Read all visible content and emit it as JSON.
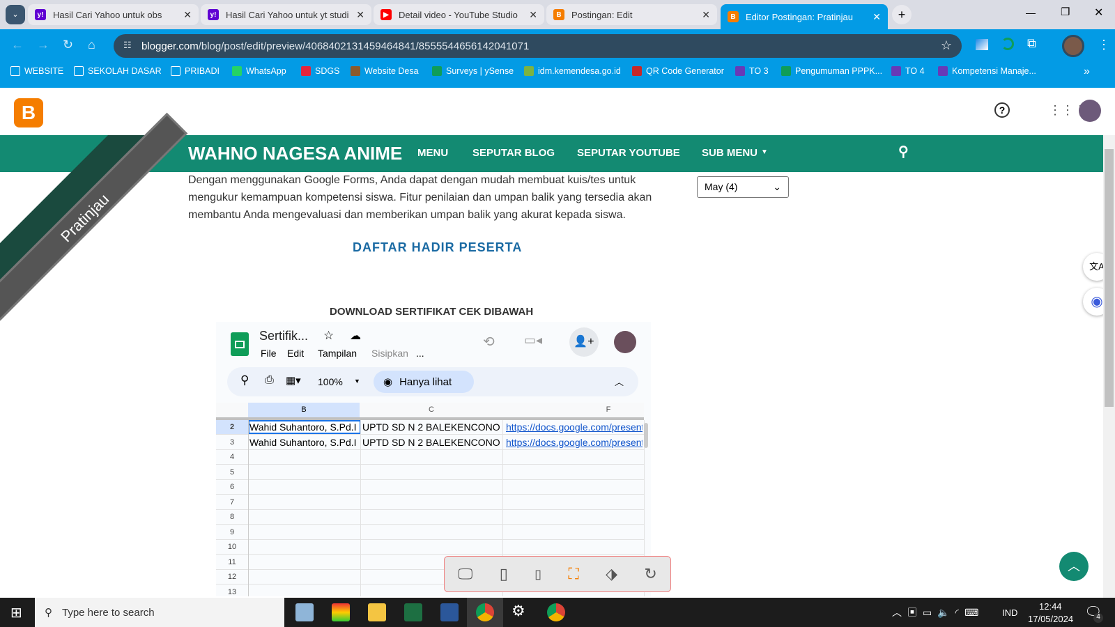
{
  "browser": {
    "tabs": [
      {
        "label": "Hasil Cari Yahoo untuk obs",
        "icon": "yahoo-icon",
        "color": "#6001d2",
        "glyph": "y!"
      },
      {
        "label": "Hasil Cari Yahoo untuk yt studio",
        "icon": "yahoo-icon",
        "color": "#6001d2",
        "glyph": "y!"
      },
      {
        "label": "Detail video - YouTube Studio",
        "icon": "youtube-icon",
        "color": "#ff0000",
        "glyph": "▶"
      },
      {
        "label": "Postingan: Edit",
        "icon": "blogger-icon",
        "color": "#f57d00",
        "glyph": "B"
      },
      {
        "label": "Editor Postingan: Pratinjau",
        "icon": "blogger-icon",
        "color": "#f57d00",
        "glyph": "B"
      }
    ],
    "url_domain": "blogger.com",
    "url_path": "/blog/post/edit/preview/4068402131459464841/8555544656142041071",
    "bookmarks": [
      "WEBSITE",
      "SEKOLAH DASAR",
      "PRIBADI",
      "WhatsApp",
      "SDGS",
      "Website Desa",
      "Surveys | ySense",
      "idm.kemendesa.go.id",
      "QR Code Generator",
      "TO 3",
      "Pengumuman PPPK...",
      "TO 4",
      "Kompetensi Manaje..."
    ]
  },
  "site": {
    "title": "WAHNO NAGESA ANIME",
    "nav": [
      "MENU",
      "SEPUTAR BLOG",
      "SEPUTAR YOUTUBE",
      "SUB MENU"
    ],
    "ribbon": "Pratinjau",
    "paragraph": "Dengan menggunakan Google Forms, Anda dapat dengan mudah membuat kuis/tes untuk mengukur kemampuan kompetensi siswa. Fitur penilaian dan umpan balik yang tersedia akan membantu Anda mengevaluasi dan memberikan umpan balik yang akurat kepada siswa.",
    "heading": "DAFTAR HADIR PESERTA",
    "subheading": "DOWNLOAD SERTIFIKAT CEK DIBAWAH",
    "archive_select": "May (4)"
  },
  "sheet": {
    "title": "Sertifik...",
    "menus": [
      "File",
      "Edit",
      "Tampilan",
      "Sisipkan",
      "..."
    ],
    "zoom": "100%",
    "view_mode": "Hanya lihat",
    "columns": [
      "B",
      "C",
      "F"
    ],
    "rows": [
      {
        "n": "2",
        "b": "Wahid Suhantoro, S.Pd.I",
        "c": "UPTD SD N 2 BALEKENCONO",
        "f": "https://docs.google.com/present"
      },
      {
        "n": "3",
        "b": "Wahid Suhantoro, S.Pd.I",
        "c": "UPTD SD N 2 BALEKENCONO",
        "f": "https://docs.google.com/present"
      },
      {
        "n": "4"
      },
      {
        "n": "5"
      },
      {
        "n": "6"
      },
      {
        "n": "7"
      },
      {
        "n": "8"
      },
      {
        "n": "9"
      },
      {
        "n": "10"
      },
      {
        "n": "11"
      },
      {
        "n": "12"
      },
      {
        "n": "13"
      }
    ]
  },
  "taskbar": {
    "search_placeholder": "Type here to search",
    "lang": "IND",
    "time": "12:44",
    "date": "17/05/2024",
    "notifications": "4"
  }
}
